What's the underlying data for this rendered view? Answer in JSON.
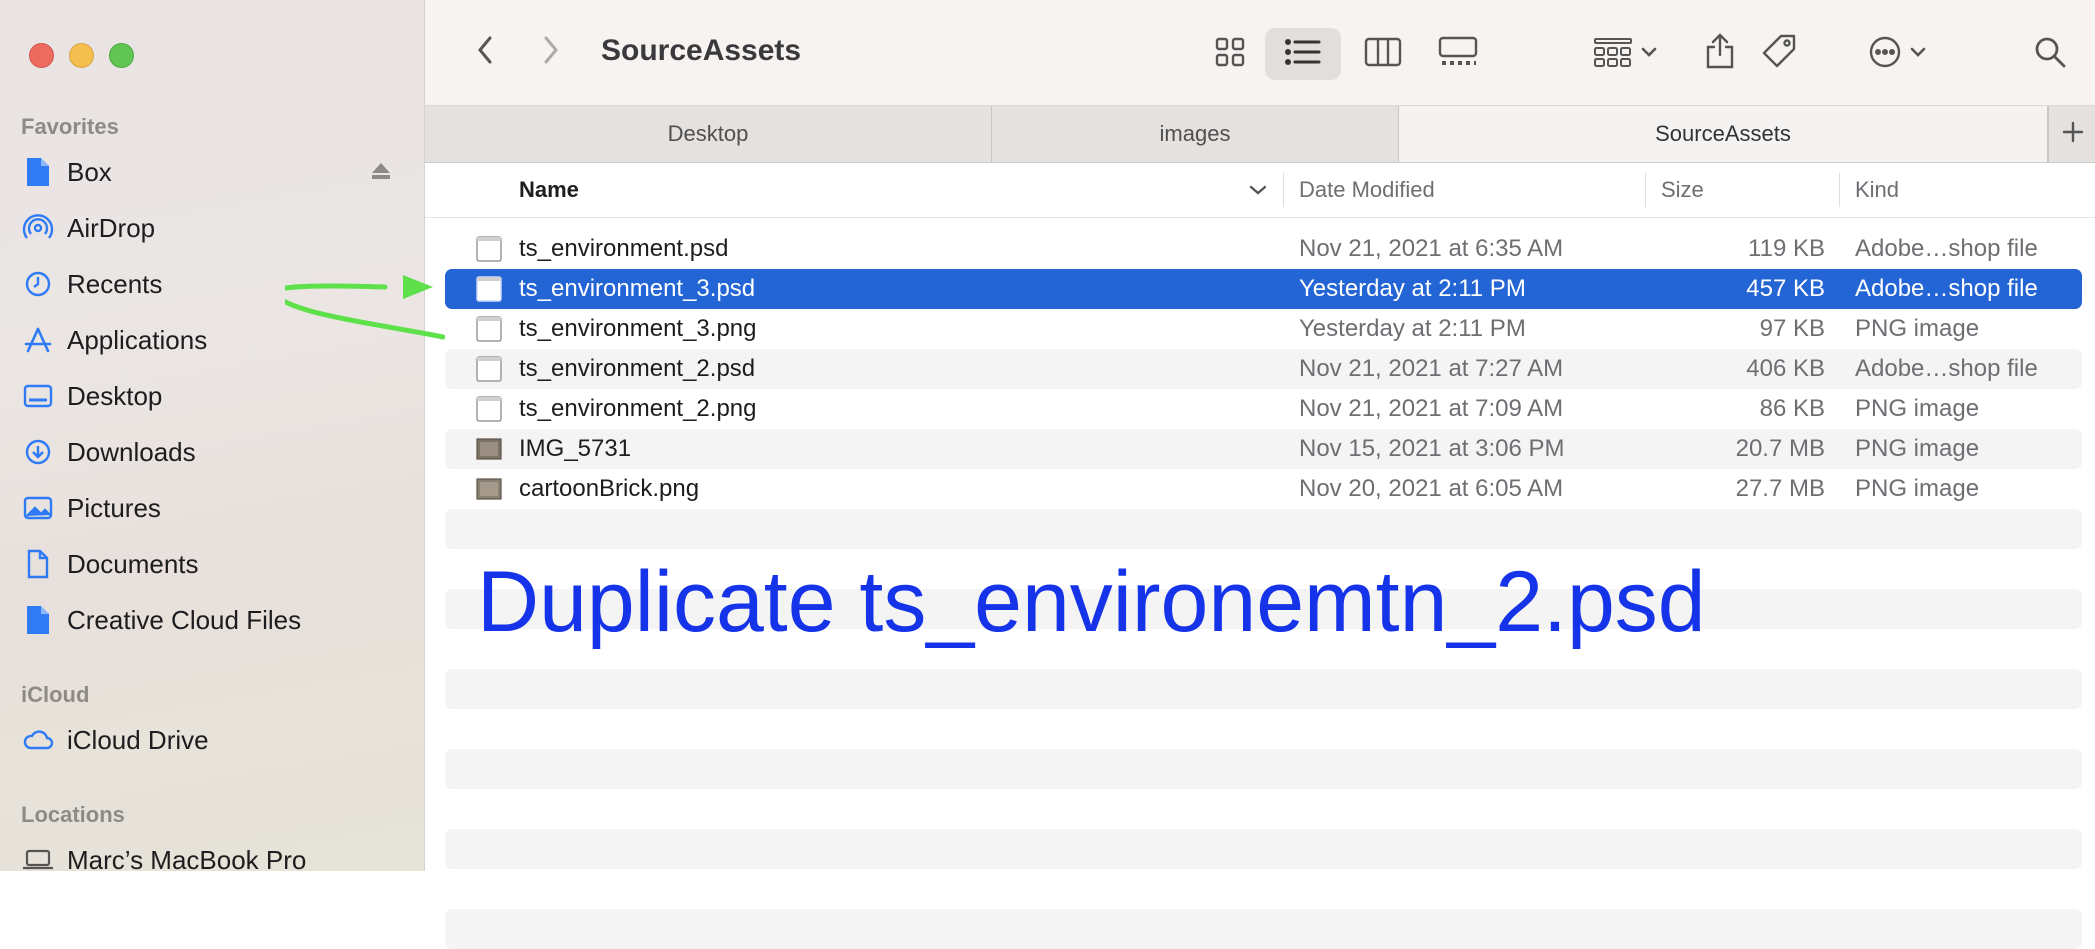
{
  "window": {
    "title": "SourceAssets"
  },
  "sidebar": {
    "sections": [
      {
        "label": "Favorites"
      },
      {
        "label": "iCloud"
      },
      {
        "label": "Locations"
      }
    ],
    "favorites": [
      {
        "label": "Box",
        "icon": "file-icon"
      },
      {
        "label": "AirDrop",
        "icon": "airdrop-icon"
      },
      {
        "label": "Recents",
        "icon": "clock-icon"
      },
      {
        "label": "Applications",
        "icon": "applications-icon"
      },
      {
        "label": "Desktop",
        "icon": "desktop-icon"
      },
      {
        "label": "Downloads",
        "icon": "download-icon"
      },
      {
        "label": "Pictures",
        "icon": "photo-icon"
      },
      {
        "label": "Documents",
        "icon": "document-icon"
      },
      {
        "label": "Creative Cloud Files",
        "icon": "file-icon"
      }
    ],
    "icloud": [
      {
        "label": "iCloud Drive",
        "icon": "cloud-icon"
      }
    ],
    "locations": [
      {
        "label": "Marc’s MacBook Pro",
        "icon": "laptop-icon"
      }
    ]
  },
  "tabs": [
    {
      "label": "Desktop",
      "active": false
    },
    {
      "label": "images",
      "active": false
    },
    {
      "label": "SourceAssets",
      "active": true
    }
  ],
  "columns": {
    "name": "Name",
    "date": "Date Modified",
    "size": "Size",
    "kind": "Kind"
  },
  "files": [
    {
      "name": "ts_environment.psd",
      "date": "Nov 21, 2021 at 6:35 AM",
      "size": "119 KB",
      "kind": "Adobe…shop file",
      "selected": false,
      "thumb": "document"
    },
    {
      "name": "ts_environment_3.psd",
      "date": "Yesterday at 2:11 PM",
      "size": "457 KB",
      "kind": "Adobe…shop file",
      "selected": true,
      "thumb": "document"
    },
    {
      "name": "ts_environment_3.png",
      "date": "Yesterday at 2:11 PM",
      "size": "97 KB",
      "kind": "PNG image",
      "selected": false,
      "thumb": "document"
    },
    {
      "name": "ts_environment_2.psd",
      "date": "Nov 21, 2021 at 7:27 AM",
      "size": "406 KB",
      "kind": "Adobe…shop file",
      "selected": false,
      "thumb": "document"
    },
    {
      "name": "ts_environment_2.png",
      "date": "Nov 21, 2021 at 7:09 AM",
      "size": "86 KB",
      "kind": "PNG image",
      "selected": false,
      "thumb": "document"
    },
    {
      "name": "IMG_5731",
      "date": "Nov 15, 2021 at 3:06 PM",
      "size": "20.7 MB",
      "kind": "PNG image",
      "selected": false,
      "thumb": "image"
    },
    {
      "name": "cartoonBrick.png",
      "date": "Nov 20, 2021 at 6:05 AM",
      "size": "27.7 MB",
      "kind": "PNG image",
      "selected": false,
      "thumb": "image"
    }
  ],
  "annotation": {
    "text": "Duplicate ts_environemtn_2.psd",
    "text_color": "#1533e8",
    "arrow_color": "#5ee04a"
  },
  "colors": {
    "selection": "#2465d6",
    "accent": "#2f7bf5"
  }
}
